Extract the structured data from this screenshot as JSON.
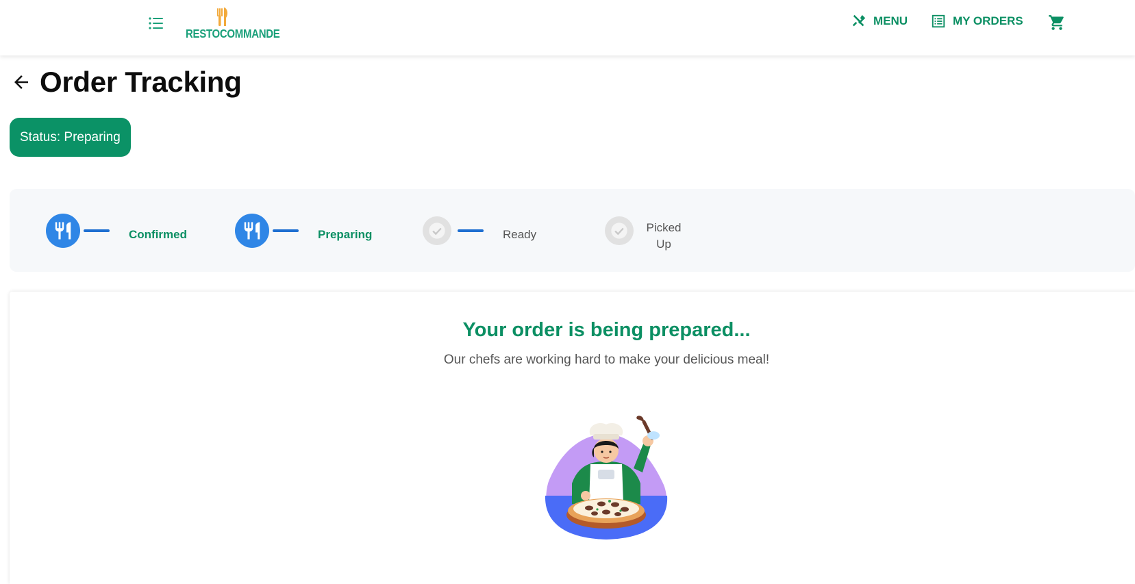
{
  "header": {
    "logo_text": "RESTOCOMMANDE",
    "nav": {
      "menu_label": "MENU",
      "orders_label": "MY ORDERS"
    }
  },
  "page": {
    "title": "Order Tracking",
    "status_text": "Status: Preparing"
  },
  "stepper": {
    "steps": [
      {
        "label": "Confirmed",
        "state": "done"
      },
      {
        "label": "Preparing",
        "state": "current"
      },
      {
        "label": "Ready",
        "state": "pending"
      },
      {
        "label": "Picked\nUp",
        "state": "pending"
      }
    ]
  },
  "card": {
    "headline": "Your order is being prepared...",
    "subtitle": "Our chefs are working hard to make your delicious meal!"
  },
  "colors": {
    "brand_green": "#0b9266",
    "step_blue": "#2f86e6",
    "line_blue": "#1e6fd1",
    "inactive_grey": "#e1e1e1"
  }
}
